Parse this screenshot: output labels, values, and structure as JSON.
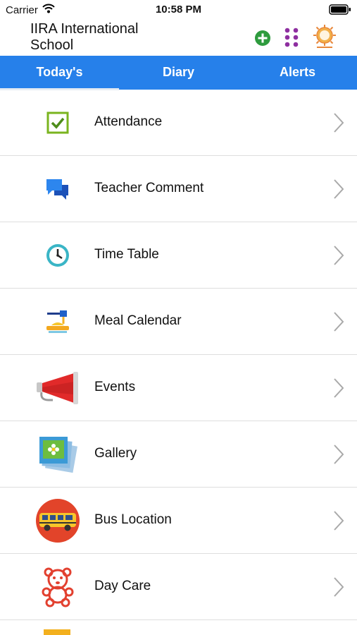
{
  "status": {
    "carrier": "Carrier",
    "time": "10:58 PM"
  },
  "header": {
    "title": "IIRA International School"
  },
  "tabs": [
    {
      "label": "Today's",
      "active": true
    },
    {
      "label": "Diary",
      "active": false
    },
    {
      "label": "Alerts",
      "active": false
    }
  ],
  "menu": [
    {
      "label": "Attendance",
      "icon": "attendance-checkbox-icon"
    },
    {
      "label": "Teacher Comment",
      "icon": "chat-bubbles-icon"
    },
    {
      "label": "Time Table",
      "icon": "clock-icon"
    },
    {
      "label": "Meal Calendar",
      "icon": "meal-icon"
    },
    {
      "label": "Events",
      "icon": "megaphone-icon"
    },
    {
      "label": "Gallery",
      "icon": "gallery-photos-icon"
    },
    {
      "label": "Bus Location",
      "icon": "school-bus-icon"
    },
    {
      "label": "Day Care",
      "icon": "teddy-bear-icon"
    }
  ],
  "colors": {
    "tab_bar": "#2680ea",
    "add_green": "#2e9b3e",
    "apps_purple": "#8e2fa0"
  }
}
